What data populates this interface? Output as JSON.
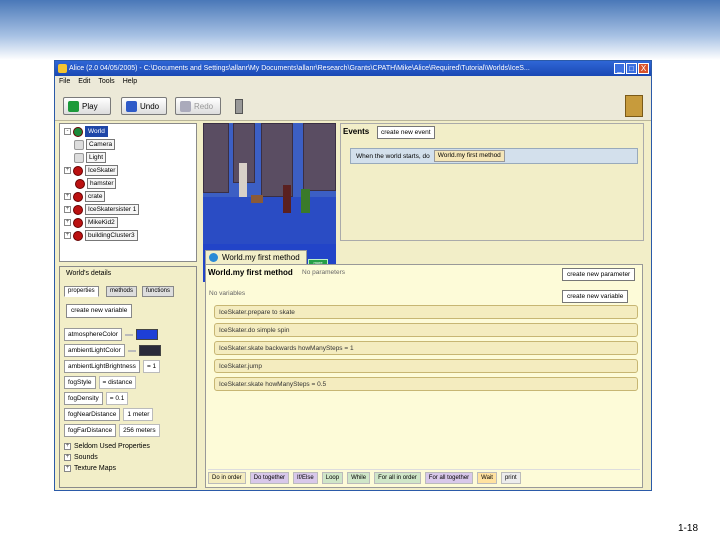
{
  "window": {
    "title": "Alice (2.0 04/05/2005) - C:\\Documents and Settings\\allanr\\My Documents\\allanr\\Research\\Grants\\CPATH\\Mike\\Alice\\Required\\Tutorial\\Worlds\\IceS...",
    "minimize": "_",
    "maximize": "□",
    "close": "X"
  },
  "menu": [
    "File",
    "Edit",
    "Tools",
    "Help"
  ],
  "toolbar": {
    "play": "Play",
    "undo": "Undo",
    "redo": "Redo"
  },
  "tree": {
    "items": [
      "World",
      "Camera",
      "Light",
      "IceSkater",
      "hamster",
      "crate",
      "IceSkatersister 1",
      "MikeKid2",
      "buildingCluster3"
    ]
  },
  "details": {
    "title": "World's details",
    "tabs": [
      "properties",
      "methods",
      "functions"
    ],
    "create_var": "create new variable",
    "props": [
      {
        "name": "atmosphereColor",
        "value": ""
      },
      {
        "name": "ambientLightColor",
        "value": ""
      },
      {
        "name": "ambientLightBrightness",
        "value": "= 1"
      },
      {
        "name": "fogStyle",
        "value": "= distance"
      },
      {
        "name": "fogDensity",
        "value": "= 0.1"
      },
      {
        "name": "fogNearDistance",
        "value": "1 meter"
      },
      {
        "name": "fogFarDistance",
        "value": "256 meters"
      }
    ],
    "groups": [
      "Seldom Used Properties",
      "Sounds",
      "Texture Maps"
    ],
    "colors": {
      "atmosphere": "#1e3fd6",
      "ambient": "#2a2a3a"
    }
  },
  "scene": {
    "more_controls": "more controls"
  },
  "events": {
    "title": "Events",
    "create_btn": "create new event",
    "when": "When the world starts, do",
    "method": "World.my first method"
  },
  "editor": {
    "tab": "World.my first method",
    "method_name": "World.my first method",
    "no_params": "No parameters",
    "no_vars": "No variables",
    "create_param": "create new parameter",
    "create_var": "create new variable",
    "statements": [
      "IceSkater.prepare to skate",
      "IceSkater.do simple spin",
      "IceSkater.skate backwards howManySteps = 1",
      "IceSkater.jump",
      "IceSkater.skate howManySteps = 0.5"
    ],
    "controls": [
      "Do in order",
      "Do together",
      "If/Else",
      "Loop",
      "While",
      "For all in order",
      "For all together",
      "Wait",
      "print"
    ]
  },
  "page_number": "1-18"
}
